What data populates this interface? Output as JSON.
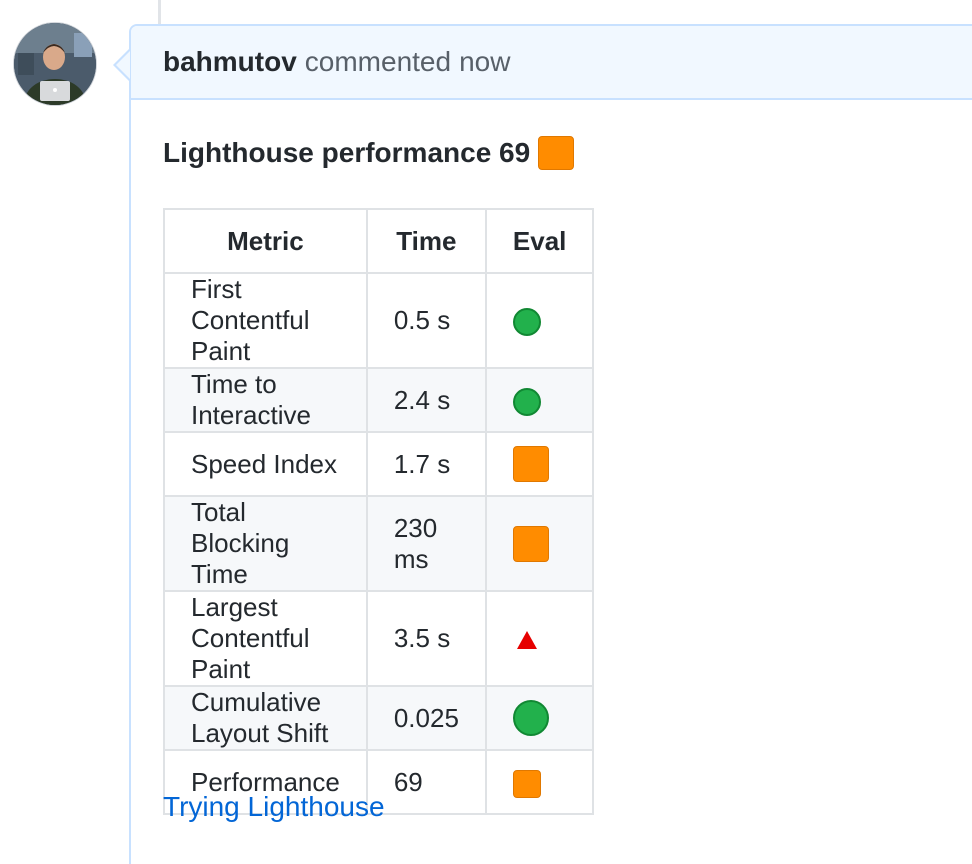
{
  "comment": {
    "author": "bahmutov",
    "action": "commented",
    "time": "now",
    "heading": "Lighthouse performance 69",
    "heading_eval": "orange-square",
    "table": {
      "headers": [
        "Metric",
        "Time",
        "Eval"
      ],
      "rows": [
        {
          "metric": "First Contentful Paint",
          "time": "0.5 s",
          "eval": "green-circle"
        },
        {
          "metric": "Time to Interactive",
          "time": "2.4 s",
          "eval": "green-circle"
        },
        {
          "metric": "Speed Index",
          "time": "1.7 s",
          "eval": "orange-square"
        },
        {
          "metric": "Total Blocking Time",
          "time": "230 ms",
          "eval": "orange-square"
        },
        {
          "metric": "Largest Contentful Paint",
          "time": "3.5 s",
          "eval": "red-triangle"
        },
        {
          "metric": "Cumulative Layout Shift",
          "time": "0.025",
          "eval": "green-circle"
        },
        {
          "metric": "Performance",
          "time": "69",
          "eval": "orange-square"
        }
      ]
    },
    "link_text": "Trying Lighthouse"
  },
  "colors": {
    "header_bg": "#f1f8ff",
    "header_border": "#c8e1ff",
    "link": "#0366d6",
    "eval_good": "#22b14c",
    "eval_average": "#ff8c00",
    "eval_poor": "#e60000"
  }
}
